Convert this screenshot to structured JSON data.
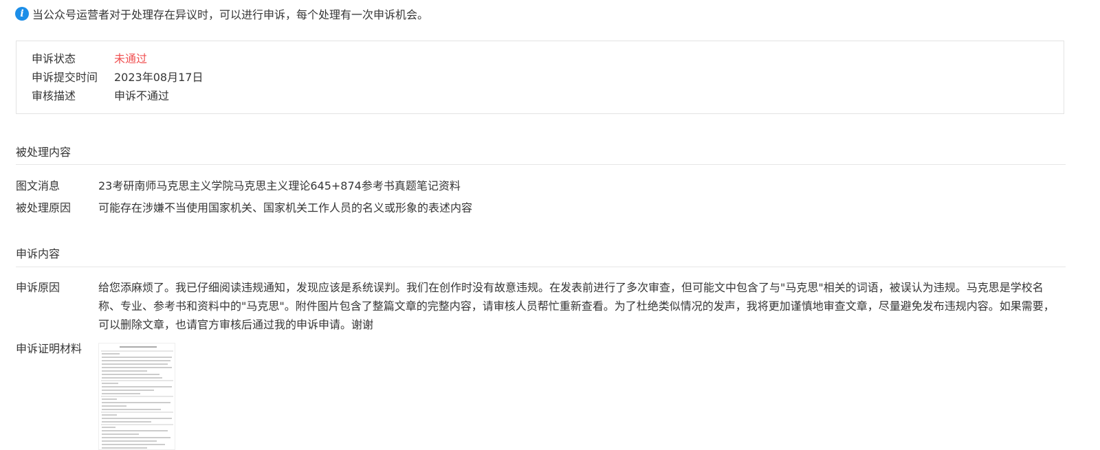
{
  "notice": {
    "icon": "info-icon",
    "text": "当公众号运营者对于处理存在异议时，可以进行申诉，每个处理有一次申诉机会。"
  },
  "appeal_status": {
    "status_label": "申诉状态",
    "status_value": "未通过",
    "status_color": "#f05152",
    "submit_time_label": "申诉提交时间",
    "submit_time_value": "2023年08月17日",
    "review_label": "审核描述",
    "review_value": "申诉不通过"
  },
  "processed_content": {
    "title": "被处理内容",
    "article_label": "图文消息",
    "article_value": "23考研南师马克思主义学院马克思主义理论645+874参考书真题笔记资料",
    "reason_label": "被处理原因",
    "reason_value": "可能存在涉嫌不当使用国家机关、国家机关工作人员的名义或形象的表述内容"
  },
  "appeal_content": {
    "title": "申诉内容",
    "reason_label": "申诉原因",
    "reason_value": "给您添麻烦了。我已仔细阅读违规通知，发现应该是系统误判。我们在创作时没有故意违规。在发表前进行了多次审查，但可能文中包含了与\"马克思\"相关的词语，被误认为违规。马克思是学校名称、专业、参考书和资料中的\"马克思\"。附件图片包含了整篇文章的完整内容，请审核人员帮忙重新查看。为了杜绝类似情况的发声，我将更加谨慎地审查文章，尽量避免发布违规内容。如果需要，可以删除文章，也请官方审核后通过我的申诉申请。谢谢",
    "proof_label": "申诉证明材料",
    "proof_image": "document-screenshot-thumbnail"
  }
}
